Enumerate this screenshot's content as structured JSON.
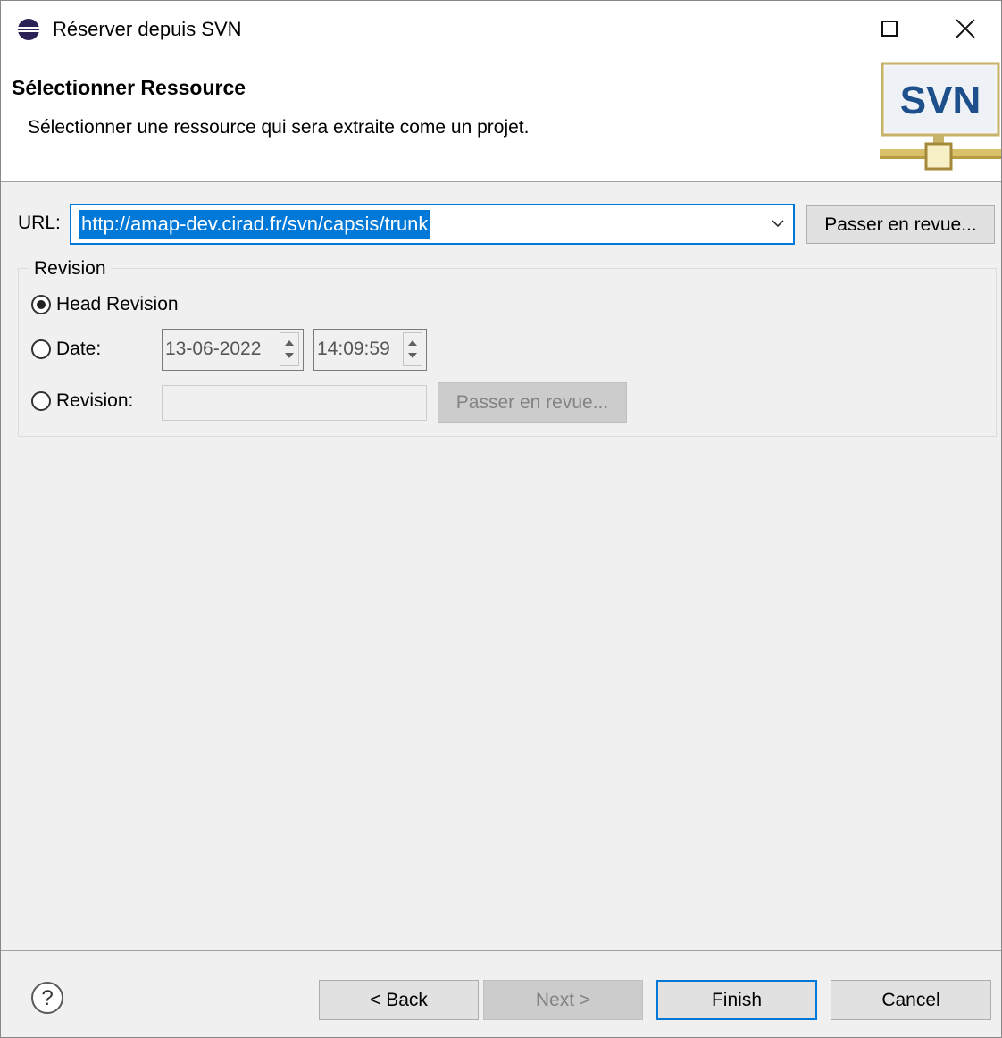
{
  "window": {
    "title": "Réserver depuis SVN"
  },
  "banner": {
    "title": "Sélectionner Ressource",
    "description": "Sélectionner une ressource qui sera extraite come un projet.",
    "logo_text": "SVN"
  },
  "url": {
    "label": "URL:",
    "value": "http://amap-dev.cirad.fr/svn/capsis/trunk",
    "browse_label": "Passer en revue..."
  },
  "revision": {
    "group_label": "Revision",
    "head_label": "Head Revision",
    "date_label": "Date:",
    "date_value": "13-06-2022",
    "time_value": "14:09:59",
    "revision_label": "Revision:",
    "revision_value": "",
    "browse_label": "Passer en revue...",
    "selected": "head"
  },
  "footer": {
    "back_label": "< Back",
    "next_label": "Next >",
    "finish_label": "Finish",
    "cancel_label": "Cancel"
  },
  "colors": {
    "accent": "#0078d7",
    "svn_logo_blue": "#1d4f8c",
    "svn_logo_gold": "#d9c06a"
  },
  "icons": [
    "eclipse-app-icon",
    "minimize-icon",
    "maximize-icon",
    "close-icon",
    "svn-logo",
    "chevron-down-icon",
    "help-icon"
  ]
}
